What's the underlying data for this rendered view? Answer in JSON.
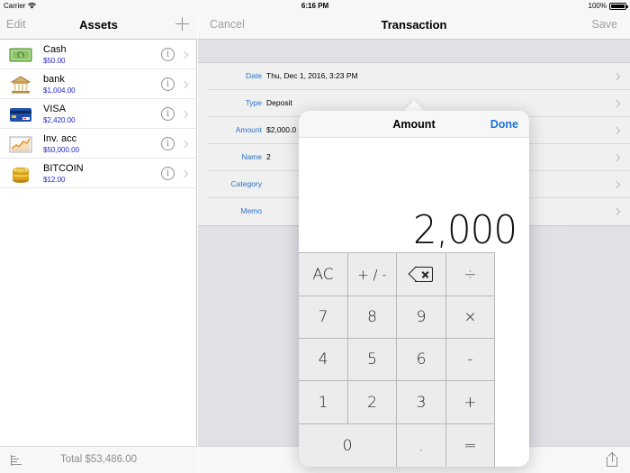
{
  "status_bar": {
    "carrier": "Carrier",
    "time": "6:16 PM",
    "battery": "100%",
    "battery_level": 1.0
  },
  "master": {
    "edit_label": "Edit",
    "title": "Assets",
    "add_icon": "plus-icon",
    "assets": [
      {
        "name": "Cash",
        "value": "$50.00",
        "icon": "cash-icon"
      },
      {
        "name": "bank",
        "value": "$1,004.00",
        "icon": "bank-icon"
      },
      {
        "name": "VISA",
        "value": "$2,420.00",
        "icon": "credit-card-icon"
      },
      {
        "name": "Inv. acc",
        "value": "$50,000.00",
        "icon": "investment-chart-icon"
      },
      {
        "name": "BITCOIN",
        "value": "$12.00",
        "icon": "coins-icon"
      }
    ],
    "info_glyph": "i",
    "total": "Total $53,486.00"
  },
  "detail": {
    "cancel_label": "Cancel",
    "title": "Transaction",
    "save_label": "Save",
    "fields": [
      {
        "label": "Date",
        "value": "Thu, Dec 1, 2016, 3:23 PM"
      },
      {
        "label": "Type",
        "value": "Deposit"
      },
      {
        "label": "Amount",
        "value": "$2,000.0"
      },
      {
        "label": "Name",
        "value": "2"
      },
      {
        "label": "Category",
        "value": ""
      },
      {
        "label": "Memo",
        "value": ""
      }
    ]
  },
  "popover": {
    "title": "Amount",
    "done_label": "Done",
    "display": "2,000",
    "keys": [
      [
        "AC",
        "+ / -",
        "backspace",
        "÷"
      ],
      [
        "7",
        "8",
        "9",
        "×"
      ],
      [
        "4",
        "5",
        "6",
        "-"
      ],
      [
        "1",
        "2",
        "3",
        "+"
      ],
      [
        "0",
        ".",
        "="
      ]
    ]
  },
  "colors": {
    "accent": "#1a73d6",
    "field_label": "#2f7bd3",
    "asset_value": "#1d1dd2",
    "disabled_nav": "#a0a0a0"
  }
}
